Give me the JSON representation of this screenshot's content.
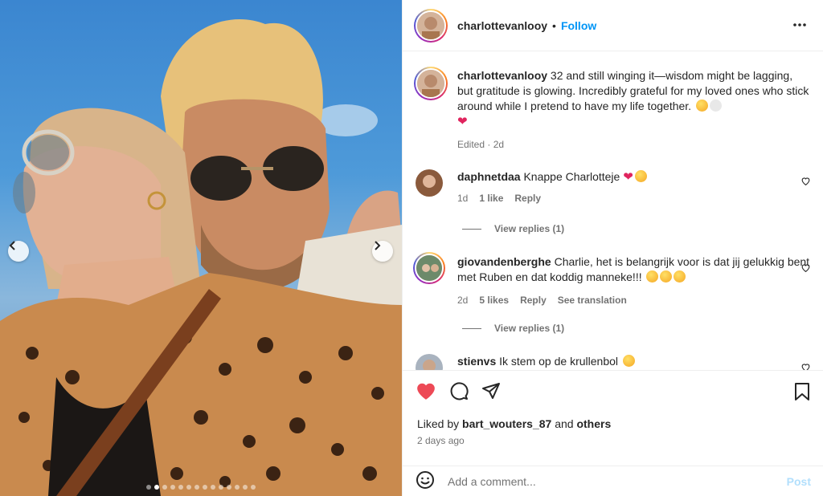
{
  "post": {
    "author": "charlottevanlooy",
    "separator": "•",
    "follow_label": "Follow",
    "caption": "32 and still winging it—wisdom might be lagging, but gratitude is glowing. Incredibly grateful for my loved ones who stick around while I pretend to have my life together.",
    "caption_meta": "Edited · 2d"
  },
  "comments": [
    {
      "username": "daphnetdaa",
      "text": "Knappe Charlotteje",
      "time": "1d",
      "likes": "1 like",
      "reply_label": "Reply",
      "view_replies": "View replies (1)"
    },
    {
      "username": "giovandenberghe",
      "text": "Charlie, het is belangrijk voor is dat jij gelukkig bent met Ruben en dat koddig manneke!!!",
      "time": "2d",
      "likes": "5 likes",
      "reply_label": "Reply",
      "translate_label": "See translation",
      "view_replies": "View replies (1)"
    },
    {
      "username": "stienvs",
      "text": "Ik stem op de krullenbol"
    }
  ],
  "liked_by": {
    "prefix": "Liked by",
    "user": "bart_wouters_87",
    "and": "and",
    "others": "others"
  },
  "posted_ago": "2 days ago",
  "add_comment": {
    "placeholder": "Add a comment...",
    "post_label": "Post"
  },
  "carousel": {
    "total_slides": 14,
    "active_index": 1
  },
  "colors": {
    "accent": "#0095f6",
    "liked_heart": "#ed4956",
    "muted": "#737373"
  },
  "icons": [
    "carousel-prev-icon",
    "carousel-next-icon",
    "more-options-icon",
    "heart-icon",
    "comment-icon",
    "share-icon",
    "bookmark-icon",
    "emoji-icon"
  ]
}
